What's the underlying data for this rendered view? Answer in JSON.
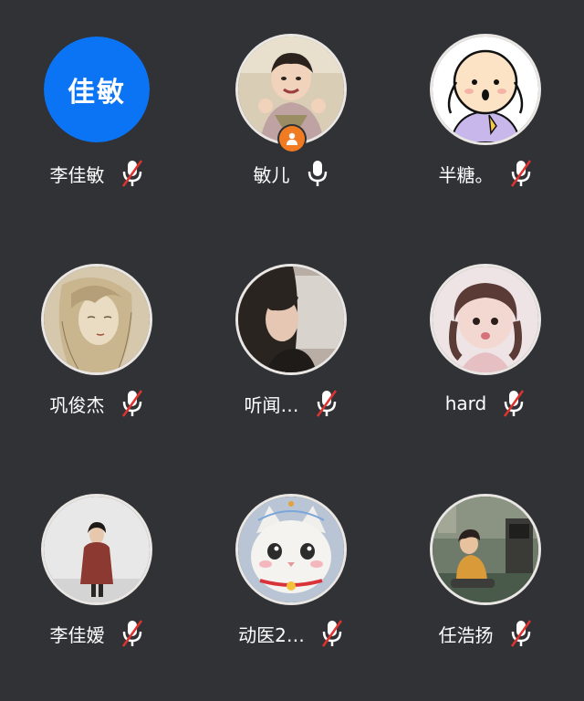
{
  "participants": [
    {
      "name": "李佳敏",
      "avatar_type": "text",
      "avatar_text": "佳敏",
      "avatar_color": "#0a74f5",
      "mic": "muted"
    },
    {
      "name": "敏儿",
      "avatar_type": "photo",
      "avatar_desc": "child-photo",
      "mic": "on",
      "host_icon": "person-icon"
    },
    {
      "name": "半糖。",
      "avatar_type": "photo",
      "avatar_desc": "cartoon-character",
      "mic": "muted"
    },
    {
      "name": "巩俊杰",
      "avatar_type": "photo",
      "avatar_desc": "anime-sketch",
      "mic": "muted"
    },
    {
      "name": "听闻…",
      "avatar_type": "photo",
      "avatar_desc": "girl-photo",
      "mic": "muted"
    },
    {
      "name": "hard",
      "avatar_type": "photo",
      "avatar_desc": "child-photo",
      "mic": "muted"
    },
    {
      "name": "李佳嫒",
      "avatar_type": "photo",
      "avatar_desc": "person-standing",
      "mic": "muted"
    },
    {
      "name": "动医2…",
      "avatar_type": "photo",
      "avatar_desc": "cat-photo",
      "mic": "muted"
    },
    {
      "name": "任浩扬",
      "avatar_type": "photo",
      "avatar_desc": "illustration-room",
      "mic": "muted"
    }
  ],
  "colors": {
    "background": "#303236",
    "muted_slash": "#e0322e",
    "host_badge": "#f07b22",
    "avatar_blue": "#0a74f5"
  }
}
